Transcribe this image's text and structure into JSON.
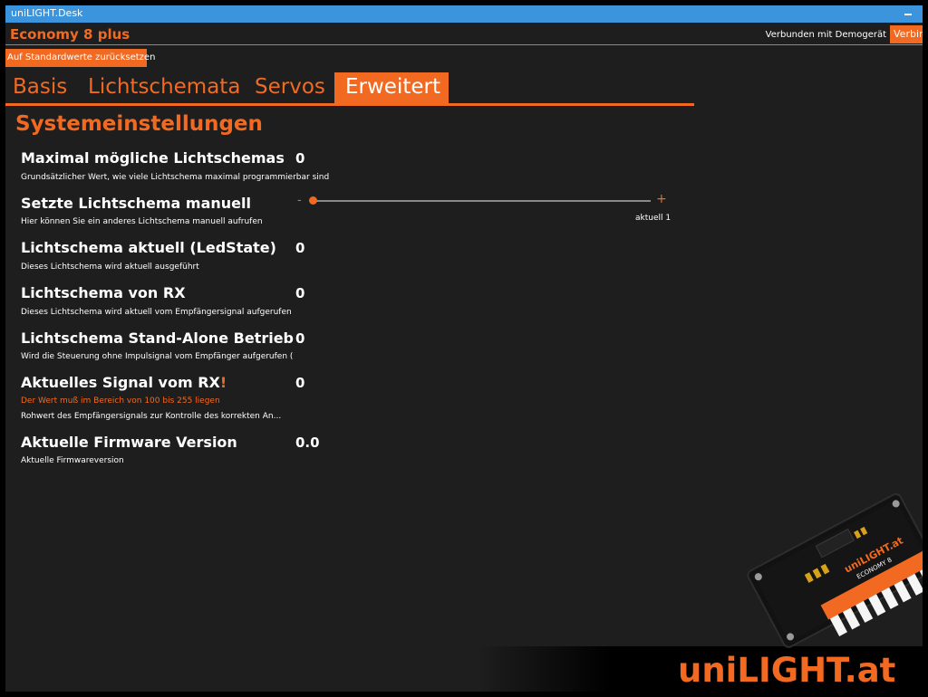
{
  "window": {
    "title": "uniLIGHT.Desk"
  },
  "header": {
    "app_name": "Economy 8 plus",
    "connection_status": "Verbunden mit Demogerät",
    "connect_button": "Verbinden"
  },
  "toolbar": {
    "reset_label": "Auf Standardwerte zurücksetzen"
  },
  "tabs": [
    {
      "label": "Basis",
      "active": false
    },
    {
      "label": "Lichtschemata",
      "active": false
    },
    {
      "label": "Servos",
      "active": false
    },
    {
      "label": "Erweitert",
      "active": true
    }
  ],
  "section": {
    "title": "Systemeinstellungen"
  },
  "settings": {
    "max_schemes": {
      "title": "Maximal mögliche Lichtschemas",
      "description": "Grundsätzlicher Wert, wie viele Lichtschema maximal programmierbar sind",
      "value": "0"
    },
    "set_scheme": {
      "title": "Setzte Lichtschema manuell",
      "description": "Hier können Sie ein anderes Lichtschema manuell aufrufen",
      "minus": "-",
      "plus": "+",
      "caption": "aktuell 1",
      "slider_fraction": 0
    },
    "current_scheme": {
      "title": "Lichtschema aktuell (LedState)",
      "description": "Dieses Lichtschema wird aktuell ausgeführt",
      "value": "0"
    },
    "rx_scheme": {
      "title": "Lichtschema von RX",
      "description": "Dieses Lichtschema wird aktuell vom Empfängersignal aufgerufen",
      "value": "0"
    },
    "standalone": {
      "title": "Lichtschema Stand-Alone Betrieb",
      "description": "Wird die Steuerung ohne Impulsignal vom Empfänger aufgerufen (Stand-A",
      "value": "0"
    },
    "rx_signal": {
      "title": "Aktuelles Signal vom RX",
      "warning_mark": "!",
      "warning": "Der Wert muß im Bereich von 100 bis 255 liegen",
      "description": "Rohwert des Empfängersignals zur Kontrolle des korrekten An...",
      "value": "0"
    },
    "firmware": {
      "title": "Aktuelle Firmware Version",
      "description": "Aktuelle Firmwareversion",
      "value": "0.0"
    }
  },
  "branding": {
    "logo": "uniLIGHT.at",
    "device_label": "uniLIGHT.at",
    "device_model": "ECONOMY 8"
  },
  "colors": {
    "accent": "#f26a21",
    "titlebar": "#3c95dc",
    "background": "#1e1e1e"
  }
}
